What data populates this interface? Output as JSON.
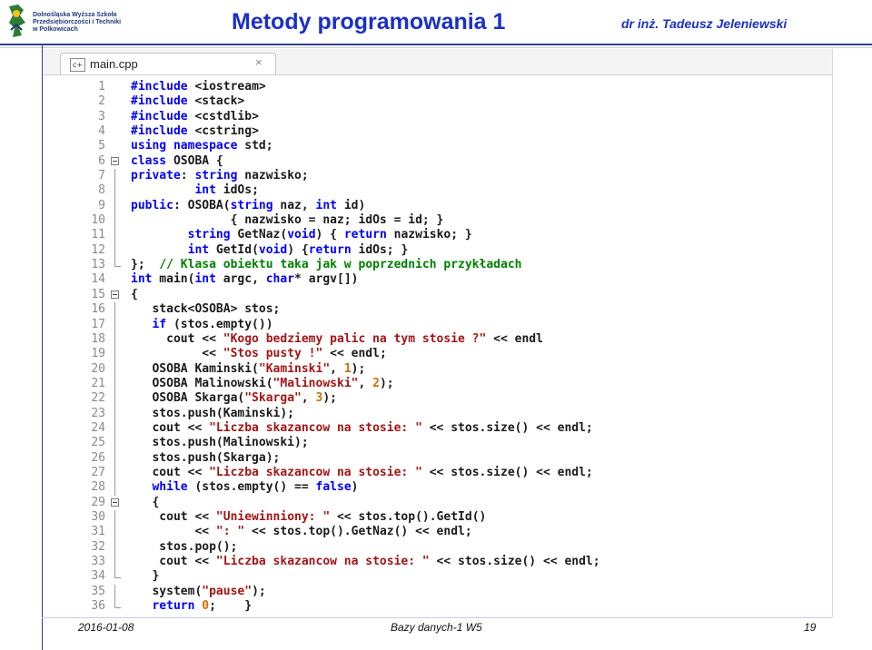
{
  "header": {
    "logo_lines": [
      "Dolnośląska Wyższa Szkoła",
      "Przedsiębiorczości i Techniki",
      "w Polkowicach"
    ],
    "title": "Metody programowania   1",
    "author": "dr inż. Tadeusz Jeleniewski"
  },
  "editor": {
    "tab_icon_text": "c+",
    "tab_label": "main.cpp",
    "tab_close": "×",
    "lines": [
      {
        "n": "1",
        "code": "#include <iostream>"
      },
      {
        "n": "2",
        "code": "#include <stack>"
      },
      {
        "n": "3",
        "code": "#include <cstdlib>"
      },
      {
        "n": "4",
        "code": "#include <cstring>"
      },
      {
        "n": "5",
        "code": "using namespace std;"
      },
      {
        "n": "6",
        "code": "class OSOBA {"
      },
      {
        "n": "7",
        "code": "private: string nazwisko;"
      },
      {
        "n": "8",
        "code": "         int idOs;"
      },
      {
        "n": "9",
        "code": "public: OSOBA(string naz, int id)"
      },
      {
        "n": "10",
        "code": "              { nazwisko = naz; idOs = id; }"
      },
      {
        "n": "11",
        "code": "        string GetNaz(void) { return nazwisko; }"
      },
      {
        "n": "12",
        "code": "        int GetId(void) {return idOs; }"
      },
      {
        "n": "13",
        "code": "};  // Klasa obiektu taka jak w poprzednich przykładach"
      },
      {
        "n": "14",
        "code": "int main(int argc, char* argv[])"
      },
      {
        "n": "15",
        "code": "{"
      },
      {
        "n": "16",
        "code": "   stack<OSOBA> stos;"
      },
      {
        "n": "17",
        "code": "   if (stos.empty())"
      },
      {
        "n": "18",
        "code": "     cout << \"Kogo bedziemy palic na tym stosie ?\" << endl"
      },
      {
        "n": "19",
        "code": "          << \"Stos pusty !\" << endl;"
      },
      {
        "n": "20",
        "code": "   OSOBA Kaminski(\"Kaminski\", 1);"
      },
      {
        "n": "21",
        "code": "   OSOBA Malinowski(\"Malinowski\", 2);"
      },
      {
        "n": "22",
        "code": "   OSOBA Skarga(\"Skarga\", 3);"
      },
      {
        "n": "23",
        "code": "   stos.push(Kaminski);"
      },
      {
        "n": "24",
        "code": "   cout << \"Liczba skazancow na stosie: \" << stos.size() << endl;"
      },
      {
        "n": "25",
        "code": "   stos.push(Malinowski);"
      },
      {
        "n": "26",
        "code": "   stos.push(Skarga);"
      },
      {
        "n": "27",
        "code": "   cout << \"Liczba skazancow na stosie: \" << stos.size() << endl;"
      },
      {
        "n": "28",
        "code": "   while (stos.empty() == false)"
      },
      {
        "n": "29",
        "code": "   {"
      },
      {
        "n": "30",
        "code": "    cout << \"Uniewinniony: \" << stos.top().GetId()"
      },
      {
        "n": "31",
        "code": "         << \": \" << stos.top().GetNaz() << endl;"
      },
      {
        "n": "32",
        "code": "    stos.pop();"
      },
      {
        "n": "33",
        "code": "    cout << \"Liczba skazancow na stosie: \" << stos.size() << endl;"
      },
      {
        "n": "34",
        "code": "   }"
      },
      {
        "n": "35",
        "code": "   system(\"pause\");"
      },
      {
        "n": "36",
        "code": "   return 0;    }"
      }
    ]
  },
  "footer": {
    "date": "2016-01-08",
    "center": "Bazy danych-1 W5",
    "page": "19"
  }
}
